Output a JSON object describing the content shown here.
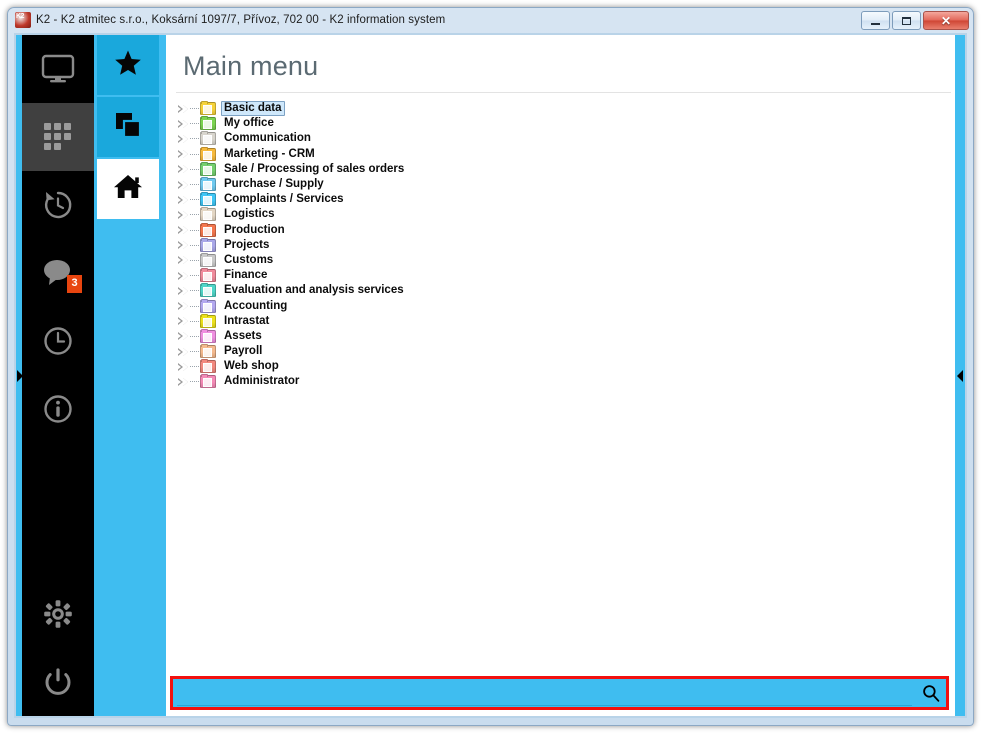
{
  "window": {
    "title": "K2 - K2 atmitec s.r.o., Koksární 1097/7, Přívoz, 702 00 - K2 information system",
    "app_icon": "k2-logo-icon",
    "buttons": {
      "minimize_label": "—",
      "maximize_label": "□",
      "close_label": "✕"
    }
  },
  "rail": {
    "items": [
      {
        "name": "monitor-icon",
        "label": "Desktop",
        "active": false,
        "badge": null
      },
      {
        "name": "apps-grid-icon",
        "label": "Applications",
        "active": true,
        "badge": null
      },
      {
        "name": "history-clock-icon",
        "label": "History",
        "active": false,
        "badge": null
      },
      {
        "name": "chat-bubble-icon",
        "label": "Messages",
        "active": false,
        "badge": "3"
      },
      {
        "name": "clock-icon",
        "label": "Time",
        "active": false,
        "badge": null
      },
      {
        "name": "info-icon",
        "label": "Information",
        "active": false,
        "badge": null
      }
    ],
    "bottom_items": [
      {
        "name": "gear-icon",
        "label": "Settings"
      },
      {
        "name": "power-icon",
        "label": "Log off"
      }
    ],
    "badge_color": "#e8450f",
    "active_bg": "#404040"
  },
  "nav": {
    "accent": "#3fbdf0",
    "items": [
      {
        "name": "star-icon",
        "label": "Favourites",
        "active": false
      },
      {
        "name": "copy-windows-icon",
        "label": "Open windows",
        "active": false
      },
      {
        "name": "home-icon",
        "label": "Main menu",
        "active": true
      }
    ]
  },
  "main": {
    "page_title": "Main menu",
    "tree": [
      {
        "label": "Basic data",
        "color": "#f5d23a",
        "selected": true
      },
      {
        "label": "My office",
        "color": "#7bd450",
        "selected": false
      },
      {
        "label": "Communication",
        "color": "#d8d5cd",
        "selected": false
      },
      {
        "label": "Marketing - CRM",
        "color": "#f6b93b",
        "selected": false
      },
      {
        "label": "Sale / Processing of sales orders",
        "color": "#74cf6e",
        "selected": false
      },
      {
        "label": "Purchase / Supply",
        "color": "#6ec9ef",
        "selected": false
      },
      {
        "label": "Complaints / Services",
        "color": "#3fc6f5",
        "selected": false
      },
      {
        "label": "Logistics",
        "color": "#e3d6c4",
        "selected": false
      },
      {
        "label": "Production",
        "color": "#f4774e",
        "selected": false
      },
      {
        "label": "Projects",
        "color": "#a9a7e8",
        "selected": false
      },
      {
        "label": "Customs",
        "color": "#c9c9c9",
        "selected": false
      },
      {
        "label": "Finance",
        "color": "#f08b9c",
        "selected": false
      },
      {
        "label": "Evaluation and analysis services",
        "color": "#4fd6c8",
        "selected": false
      },
      {
        "label": "Accounting",
        "color": "#b3a8ef",
        "selected": false
      },
      {
        "label": "Intrastat",
        "color": "#ece11c",
        "selected": false
      },
      {
        "label": "Assets",
        "color": "#ef8fe0",
        "selected": false
      },
      {
        "label": "Payroll",
        "color": "#f4b98d",
        "selected": false
      },
      {
        "label": "Web shop",
        "color": "#f2897f",
        "selected": false
      },
      {
        "label": "Administrator",
        "color": "#f48ab6",
        "selected": false
      }
    ]
  },
  "search": {
    "value": "",
    "placeholder": "",
    "icon": "search-icon",
    "highlight_color": "#f2110f",
    "background": "#3fbdf0"
  },
  "edges": {
    "left_arrow": "expand-left-panel-arrow",
    "right_arrow": "collapse-right-panel-arrow"
  }
}
